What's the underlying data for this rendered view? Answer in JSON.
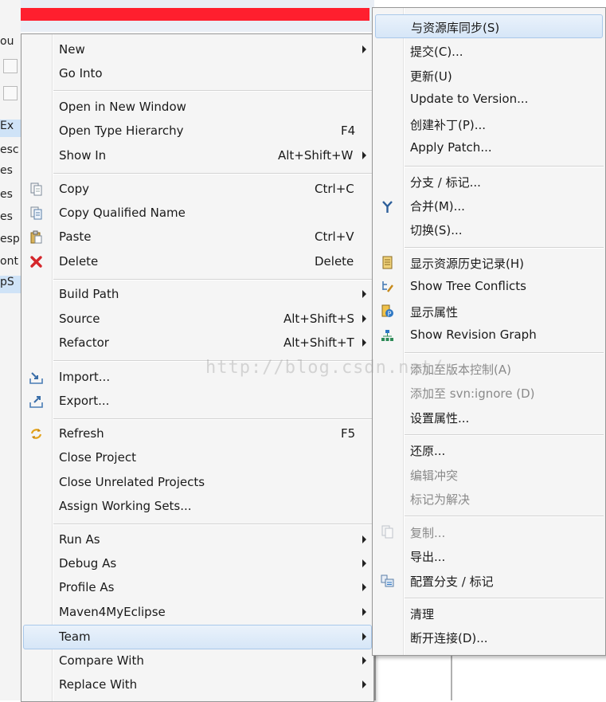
{
  "background": {
    "left_fragments": [
      "ou",
      "Ex",
      "esc",
      "es",
      "es",
      "es",
      "esp",
      "ont",
      "pS"
    ],
    "redaction_color": "#ff1f2e"
  },
  "main_menu": {
    "items": [
      {
        "label": "New",
        "accelerator": "",
        "submenu": true,
        "icon": ""
      },
      {
        "label": "Go Into",
        "accelerator": "",
        "submenu": false,
        "icon": ""
      },
      {
        "label": "Open in New Window",
        "accelerator": "",
        "submenu": false,
        "icon": ""
      },
      {
        "label": "Open Type Hierarchy",
        "accelerator": "F4",
        "submenu": false,
        "icon": ""
      },
      {
        "label": "Show In",
        "accelerator": "Alt+Shift+W",
        "submenu": true,
        "icon": ""
      },
      {
        "label": "Copy",
        "accelerator": "Ctrl+C",
        "submenu": false,
        "icon": "copy-icon"
      },
      {
        "label": "Copy Qualified Name",
        "accelerator": "",
        "submenu": false,
        "icon": "copy-qualified-name-icon"
      },
      {
        "label": "Paste",
        "accelerator": "Ctrl+V",
        "submenu": false,
        "icon": "paste-icon"
      },
      {
        "label": "Delete",
        "accelerator": "Delete",
        "submenu": false,
        "icon": "delete-icon"
      },
      {
        "label": "Build Path",
        "accelerator": "",
        "submenu": true,
        "icon": ""
      },
      {
        "label": "Source",
        "accelerator": "Alt+Shift+S",
        "submenu": true,
        "icon": ""
      },
      {
        "label": "Refactor",
        "accelerator": "Alt+Shift+T",
        "submenu": true,
        "icon": ""
      },
      {
        "label": "Import...",
        "accelerator": "",
        "submenu": false,
        "icon": "import-icon"
      },
      {
        "label": "Export...",
        "accelerator": "",
        "submenu": false,
        "icon": "export-icon"
      },
      {
        "label": "Refresh",
        "accelerator": "F5",
        "submenu": false,
        "icon": "refresh-icon"
      },
      {
        "label": "Close Project",
        "accelerator": "",
        "submenu": false,
        "icon": ""
      },
      {
        "label": "Close Unrelated Projects",
        "accelerator": "",
        "submenu": false,
        "icon": ""
      },
      {
        "label": "Assign Working Sets...",
        "accelerator": "",
        "submenu": false,
        "icon": ""
      },
      {
        "label": "Run As",
        "accelerator": "",
        "submenu": true,
        "icon": ""
      },
      {
        "label": "Debug As",
        "accelerator": "",
        "submenu": true,
        "icon": ""
      },
      {
        "label": "Profile As",
        "accelerator": "",
        "submenu": true,
        "icon": ""
      },
      {
        "label": "Maven4MyEclipse",
        "accelerator": "",
        "submenu": true,
        "icon": ""
      },
      {
        "label": "Team",
        "accelerator": "",
        "submenu": true,
        "icon": "",
        "highlighted": true
      },
      {
        "label": "Compare With",
        "accelerator": "",
        "submenu": true,
        "icon": ""
      },
      {
        "label": "Replace With",
        "accelerator": "",
        "submenu": true,
        "icon": ""
      }
    ]
  },
  "team_submenu": {
    "items": [
      {
        "label": "与资源库同步(S)",
        "icon": "",
        "enabled": true,
        "highlighted": true
      },
      {
        "label": "提交(C)...",
        "icon": "",
        "enabled": true
      },
      {
        "label": "更新(U)",
        "icon": "",
        "enabled": true
      },
      {
        "label": "Update to Version...",
        "icon": "",
        "enabled": true
      },
      {
        "label": "创建补丁(P)...",
        "icon": "",
        "enabled": true
      },
      {
        "label": "Apply Patch...",
        "icon": "",
        "enabled": true
      },
      {
        "label": "分支 / 标记...",
        "icon": "",
        "enabled": true
      },
      {
        "label": "合并(M)...",
        "icon": "merge-icon",
        "enabled": true
      },
      {
        "label": "切换(S)...",
        "icon": "",
        "enabled": true
      },
      {
        "label": "显示资源历史记录(H)",
        "icon": "history-icon",
        "enabled": true
      },
      {
        "label": "Show Tree Conflicts",
        "icon": "tree-conflicts-icon",
        "enabled": true
      },
      {
        "label": "显示属性",
        "icon": "properties-icon",
        "enabled": true
      },
      {
        "label": "Show Revision Graph",
        "icon": "revision-graph-icon",
        "enabled": true
      },
      {
        "label": "添加至版本控制(A)",
        "icon": "",
        "enabled": false
      },
      {
        "label": "添加至 svn:ignore (D)",
        "icon": "",
        "enabled": false
      },
      {
        "label": "设置属性...",
        "icon": "",
        "enabled": true
      },
      {
        "label": "还原...",
        "icon": "",
        "enabled": true
      },
      {
        "label": "编辑冲突",
        "icon": "",
        "enabled": false
      },
      {
        "label": "标记为解决",
        "icon": "",
        "enabled": false
      },
      {
        "label": "复制...",
        "icon": "copy-icon",
        "enabled": false
      },
      {
        "label": "导出...",
        "icon": "",
        "enabled": true
      },
      {
        "label": "配置分支 / 标记",
        "icon": "configure-branches-icon",
        "enabled": true
      },
      {
        "label": "清理",
        "icon": "",
        "enabled": true
      },
      {
        "label": "断开连接(D)...",
        "icon": "",
        "enabled": true
      }
    ]
  },
  "watermark": "http://blog.csdn.net/"
}
